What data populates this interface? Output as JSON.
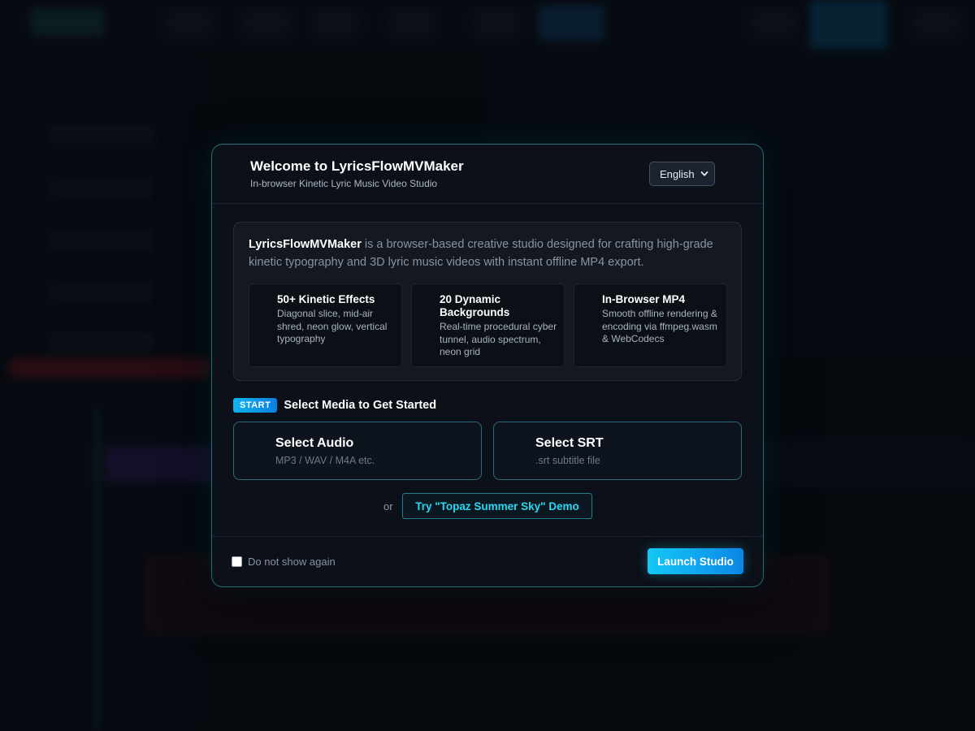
{
  "modal": {
    "title": "Welcome to LyricsFlowMVMaker",
    "subtitle": "In-browser Kinetic Lyric Music Video Studio",
    "language": {
      "selected": "English"
    },
    "intro": {
      "brand": "LyricsFlowMVMaker",
      "text": " is a browser-based creative studio designed for crafting high-grade kinetic typography and 3D lyric music videos with instant offline MP4 export."
    },
    "features": [
      {
        "icon": "text-effects-icon",
        "title": "50+ Kinetic Effects",
        "description": "Diagonal slice, mid-air shred, neon glow, vertical typography"
      },
      {
        "icon": "background-icon",
        "title": "20 Dynamic Backgrounds",
        "description": "Real-time procedural cyber tunnel, audio spectrum, neon grid"
      },
      {
        "icon": "video-export-icon",
        "title": "In-Browser MP4",
        "description": "Smooth offline rendering & encoding via ffmpeg.wasm & WebCodecs"
      }
    ],
    "start": {
      "badge": "START",
      "label": "Select Media to Get Started"
    },
    "media_buttons": [
      {
        "title": "Select Audio",
        "subtitle": "MP3 / WAV / M4A etc.",
        "icon": "audio-icon"
      },
      {
        "title": "Select SRT",
        "subtitle": ".srt subtitle file",
        "icon": "subtitle-icon"
      }
    ],
    "or_label": "or",
    "demo_label": "Try \"Topaz Summer Sky\" Demo",
    "footer": {
      "dont_show_label": "Do not show again",
      "dont_show_checked": false,
      "launch_label": "Launch Studio"
    }
  },
  "colors": {
    "accent": "#14c8f5",
    "accent_dark": "#0b86e6",
    "border_teal": "#1f6f78",
    "panel_bg": "#0c1018"
  }
}
